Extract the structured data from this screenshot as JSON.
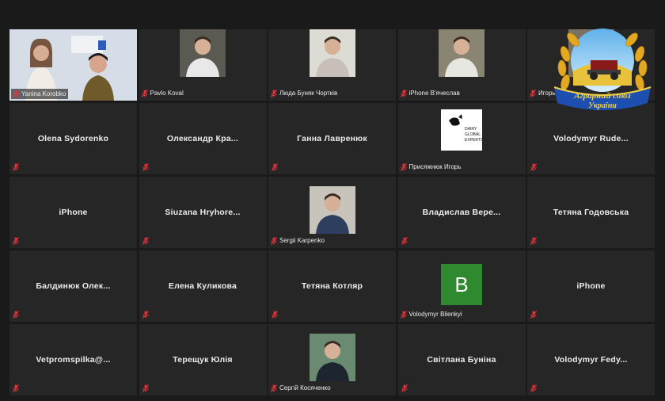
{
  "participants": [
    {
      "name": "Yanina Korobko",
      "kind": "video",
      "active": true
    },
    {
      "name": "Pavlo Koval",
      "kind": "video"
    },
    {
      "name": "Люда Буняк Чортків",
      "kind": "video"
    },
    {
      "name": "iPhone В'ячеслав",
      "kind": "video"
    },
    {
      "name": "Игорь",
      "kind": "video"
    },
    {
      "name": "Olena Sydorenko",
      "kind": "name"
    },
    {
      "name": "Олександр  Кра...",
      "kind": "name"
    },
    {
      "name": "Ганна Лавренюк",
      "kind": "name"
    },
    {
      "name": "Присяжнюк Игорь",
      "kind": "logo",
      "logo_text": [
        "DAIRY",
        "GLOBAL",
        "EXPERTS"
      ]
    },
    {
      "name": "Volodymyr  Rude...",
      "kind": "name"
    },
    {
      "name": "iPhone",
      "kind": "name"
    },
    {
      "name": "Siuzana  Hryhore...",
      "kind": "name"
    },
    {
      "name": "Sergii Karpenko",
      "kind": "video"
    },
    {
      "name": "Владислав  Вере...",
      "kind": "name"
    },
    {
      "name": "Тетяна Годовська",
      "kind": "name"
    },
    {
      "name": "Балдинюк  Олек...",
      "kind": "name"
    },
    {
      "name": "Елена Куликова",
      "kind": "name"
    },
    {
      "name": "Тетяна Котляр",
      "kind": "name"
    },
    {
      "name": "Volodymyr Bilenkyi",
      "kind": "initial",
      "initial": "B"
    },
    {
      "name": "iPhone",
      "kind": "name"
    },
    {
      "name": "Vetpromspilka@...",
      "kind": "name"
    },
    {
      "name": "Терещук Юлія",
      "kind": "name"
    },
    {
      "name": "Сергій Косяченко",
      "kind": "video"
    },
    {
      "name": "Світлана Буніна",
      "kind": "name"
    },
    {
      "name": "Volodymyr  Fedy...",
      "kind": "name"
    }
  ],
  "badge": {
    "line1": "Аграрний союз",
    "line2": "України"
  },
  "colors": {
    "mic_muted": "#e0323a",
    "active_border": "#b8d23a",
    "initial_bg": "#2f8a2f"
  }
}
